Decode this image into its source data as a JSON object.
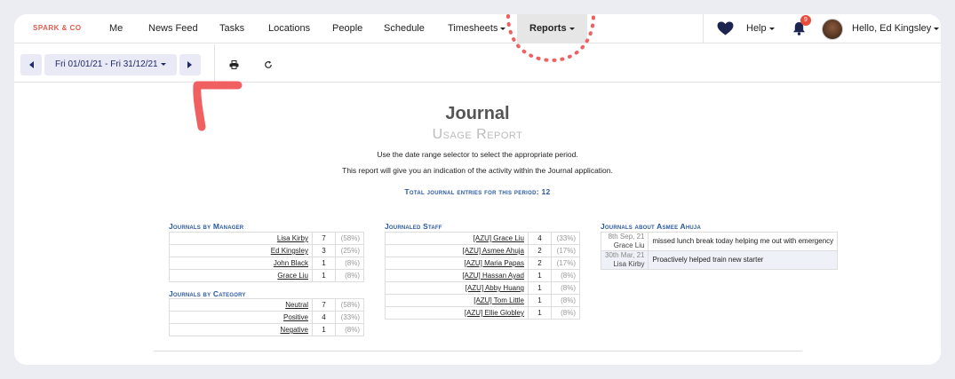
{
  "brand": "SPARK & CO",
  "nav": {
    "items": [
      {
        "label": "Me"
      },
      {
        "label": "News Feed"
      },
      {
        "label": "Tasks"
      },
      {
        "label": "Locations"
      },
      {
        "label": "People"
      },
      {
        "label": "Schedule"
      },
      {
        "label": "Timesheets"
      },
      {
        "label": "Reports"
      }
    ],
    "help_label": "Help",
    "notification_count": "9",
    "user_greeting": "Hello, Ed Kingsley"
  },
  "toolbar": {
    "date_range": "Fri 01/01/21 - Fri 31/12/21"
  },
  "report": {
    "title": "Journal",
    "subtitle": "Usage Report",
    "instruction": "Use the date range selector to select the appropriate period.",
    "description": "This report will give you an indication of the activity within the Journal application.",
    "total_label": "Total journal entries for this period:",
    "total_value": "12"
  },
  "by_manager": {
    "heading": "Journals by Manager",
    "rows": [
      {
        "name": "Lisa Kirby",
        "count": "7",
        "pct": "(58%)"
      },
      {
        "name": "Ed Kingsley",
        "count": "3",
        "pct": "(25%)"
      },
      {
        "name": "John Black",
        "count": "1",
        "pct": "(8%)"
      },
      {
        "name": "Grace Liu",
        "count": "1",
        "pct": "(8%)"
      }
    ]
  },
  "by_category": {
    "heading": "Journals by Category",
    "rows": [
      {
        "name": "Neutral",
        "count": "7",
        "pct": "(58%)"
      },
      {
        "name": "Positive",
        "count": "4",
        "pct": "(33%)"
      },
      {
        "name": "Negative",
        "count": "1",
        "pct": "(8%)"
      }
    ]
  },
  "staff": {
    "heading": "Journaled Staff",
    "rows": [
      {
        "name": "[AZU] Grace Liu",
        "count": "4",
        "pct": "(33%)"
      },
      {
        "name": "[AZU] Asmee Ahuja",
        "count": "2",
        "pct": "(17%)"
      },
      {
        "name": "[AZU] Maria Papas",
        "count": "2",
        "pct": "(17%)"
      },
      {
        "name": "[AZU] Hassan Ayad",
        "count": "1",
        "pct": "(8%)"
      },
      {
        "name": "[AZU] Abby Huang",
        "count": "1",
        "pct": "(8%)"
      },
      {
        "name": "[AZU] Tom Little",
        "count": "1",
        "pct": "(8%)"
      },
      {
        "name": "[AZU] Ellie Globley",
        "count": "1",
        "pct": "(8%)"
      }
    ]
  },
  "about": {
    "heading": "Journals about Asmee Ahuja",
    "rows": [
      {
        "date": "8th Sep, 21",
        "author": "Grace Liu",
        "note": "missed lunch break today helping me out with emergency"
      },
      {
        "date": "30th Mar, 21",
        "author": "Lisa Kirby",
        "note": "Proactively helped train new starter"
      }
    ]
  },
  "colors": {
    "accent": "#2c5aa0",
    "brand": "#e8594f",
    "annotation": "#f06060",
    "button_bg": "#eaeaf6"
  }
}
